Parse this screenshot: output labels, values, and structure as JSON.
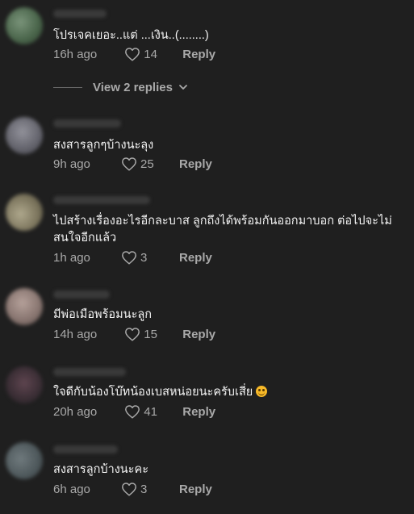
{
  "comments": [
    {
      "text": "โปรเจคเยอะ..แต่ ...เงิน..(........)",
      "time": "16h ago",
      "likes": "14",
      "reply_label": "Reply",
      "avatar_color": "#5b7a5c"
    },
    {
      "text": "สงสารลูกๆบ้างนะลุง",
      "time": "9h ago",
      "likes": "25",
      "reply_label": "Reply",
      "avatar_color": "#7b7b86"
    },
    {
      "text": "ไปสร้างเรื่องอะไรอีกละบาส ลูกถึงได้พร้อมกันออกมาบอก ต่อไปจะไม่สนใจอีกแล้ว",
      "time": "1h ago",
      "likes": "3",
      "reply_label": "Reply",
      "avatar_color": "#a29a7a"
    },
    {
      "text": "มีพ่อเมือพร้อมนะลูก",
      "time": "14h ago",
      "likes": "15",
      "reply_label": "Reply",
      "avatar_color": "#b09890"
    },
    {
      "text": "ใจดีกับน้องโบ๊ทน้องเบสหน่อยนะครับเสี่ย",
      "time": "20h ago",
      "likes": "41",
      "reply_label": "Reply",
      "avatar_color": "#4a3a44"
    },
    {
      "text": "สงสารลูกบ้างนะคะ",
      "time": "6h ago",
      "likes": "3",
      "reply_label": "Reply",
      "avatar_color": "#5e6a6e"
    }
  ],
  "view_replies": {
    "label": "View 2 replies"
  },
  "colors": {
    "background": "#1f1f1f",
    "text": "#f4f4f4",
    "secondary": "#a9a9a9",
    "emoji": "#f7b928"
  },
  "icons": {
    "like": "heart-icon",
    "expand": "chevron-down-icon",
    "emoji": "smiling-face-emoji"
  }
}
